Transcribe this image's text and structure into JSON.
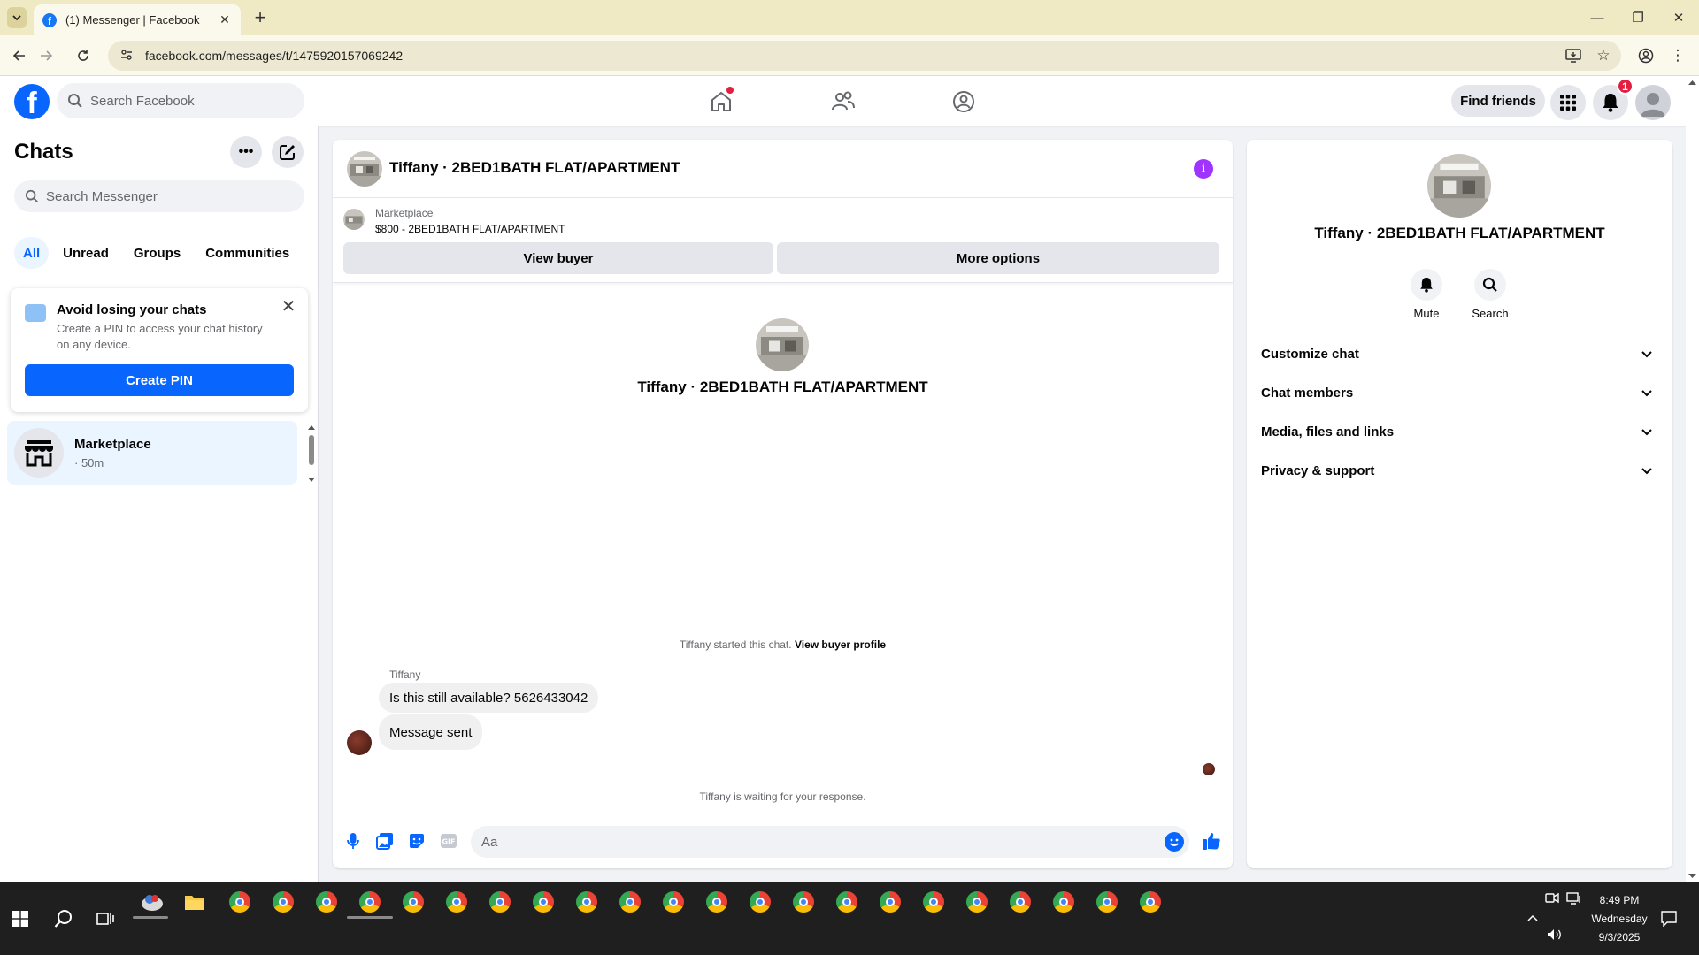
{
  "browser": {
    "tab_title": "(1) Messenger | Facebook",
    "url": "facebook.com/messages/t/1475920157069242"
  },
  "header": {
    "search_placeholder": "Search Facebook",
    "find_friends": "Find friends",
    "notifications_count": "1"
  },
  "sidebar": {
    "title": "Chats",
    "search_placeholder": "Search Messenger",
    "filters": [
      "All",
      "Unread",
      "Groups",
      "Communities"
    ],
    "pin_card": {
      "title": "Avoid losing your chats",
      "description": "Create a PIN to access your chat history on any device.",
      "button": "Create PIN"
    },
    "chats": [
      {
        "name": "Marketplace",
        "time": "· 50m"
      }
    ]
  },
  "conversation": {
    "title": "Tiffany · 2BED1BATH FLAT/APARTMENT",
    "marketplace_label": "Marketplace",
    "listing": "$800 - 2BED1BATH FLAT/APARTMENT",
    "view_buyer": "View buyer",
    "more_options": "More options",
    "started_text": "Tiffany started this chat.",
    "view_profile": "View buyer profile",
    "sender": "Tiffany",
    "messages": [
      "Is this still available? 5626433042",
      "Message sent"
    ],
    "waiting": "Tiffany is waiting for your response.",
    "composer_placeholder": "Aa"
  },
  "info_panel": {
    "name": "Tiffany · 2BED1BATH FLAT/APARTMENT",
    "mute": "Mute",
    "search": "Search",
    "sections": [
      "Customize chat",
      "Chat members",
      "Media, files and links",
      "Privacy & support"
    ]
  },
  "taskbar": {
    "time": "8:49 PM",
    "day": "Wednesday",
    "date": "9/3/2025"
  },
  "colors": {
    "brand": "#0866ff",
    "badge": "#e41e3f",
    "info": "#a033ff",
    "selected": "#ebf5ff"
  }
}
